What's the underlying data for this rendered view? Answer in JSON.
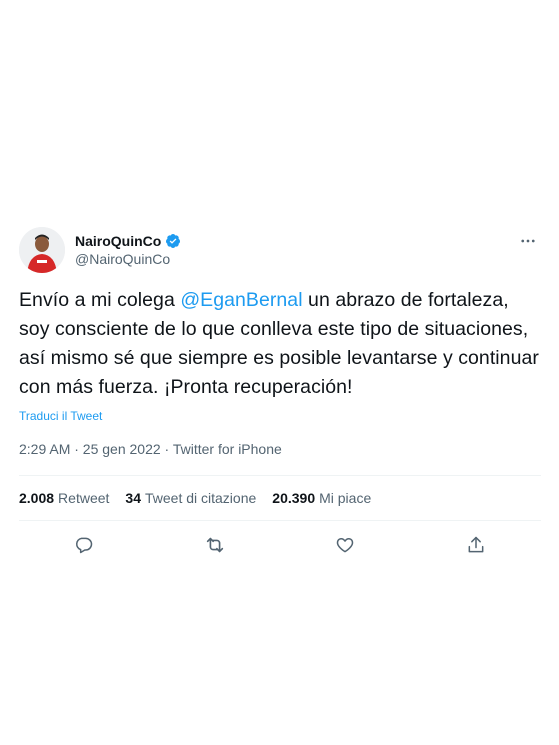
{
  "author": {
    "display_name": "NairoQuinCo",
    "handle": "@NairoQuinCo",
    "verified": true
  },
  "tweet": {
    "text_before": "Envío a mi colega ",
    "mention": "@EganBernal",
    "text_after": " un abrazo de fortaleza, soy consciente de lo que conlleva este tipo de situaciones, así mismo sé que siempre es posible levantarse y continuar con más fuerza. ¡Pronta recuperación!",
    "translate_label": "Traduci il Tweet",
    "timestamp": "2:29 AM · 25 gen 2022 · Twitter for iPhone"
  },
  "stats": {
    "retweets_count": "2.008",
    "retweets_label": "Retweet",
    "quotes_count": "34",
    "quotes_label": "Tweet di citazione",
    "likes_count": "20.390",
    "likes_label": "Mi piace"
  },
  "colors": {
    "accent": "#1d9bf0",
    "text": "#0f1419",
    "secondary": "#536471"
  },
  "icons": [
    "verified-badge-icon",
    "more-options-icon",
    "reply-icon",
    "retweet-icon",
    "like-icon",
    "share-icon"
  ]
}
